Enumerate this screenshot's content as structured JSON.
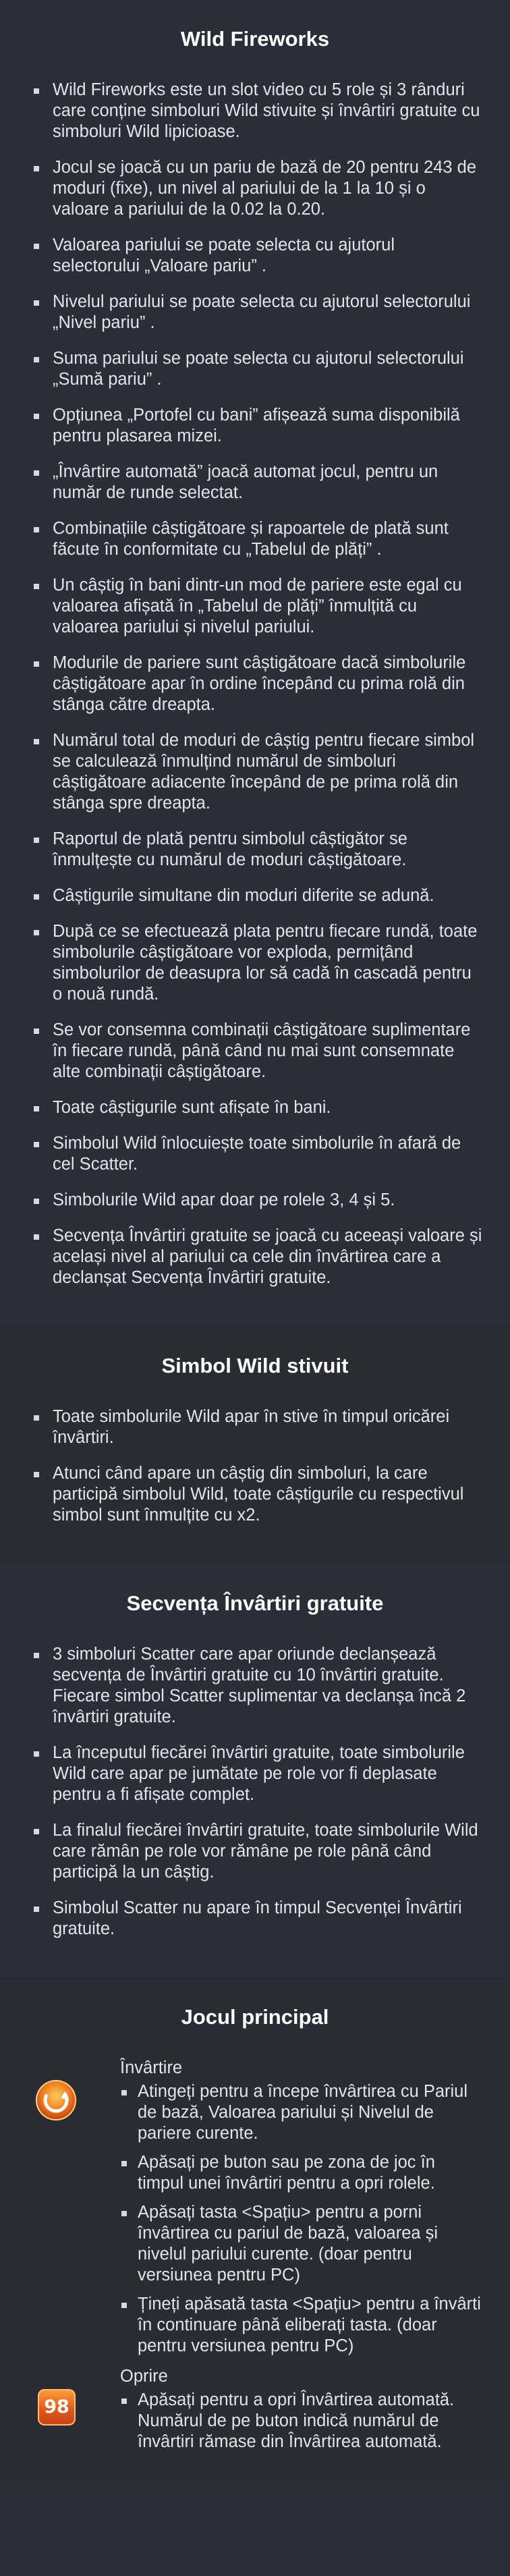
{
  "sections": [
    {
      "title": "Wild Fireworks",
      "items": [
        "Wild Fireworks este un slot video cu 5 role și 3 rânduri care conține simboluri Wild stivuite și învârtiri gratuite cu simboluri Wild lipicioase.",
        "Jocul se joacă cu un pariu de bază de 20 pentru 243 de moduri (fixe), un nivel al pariului de la 1 la 10 și o valoare a pariului de la 0.02 la 0.20.",
        "Valoarea pariului se poate selecta cu ajutorul selectorului „Valoare pariu”  .",
        "Nivelul pariului se poate selecta cu ajutorul selectorului „Nivel pariu”  .",
        "Suma pariului se poate selecta cu ajutorul selectorului „Sumă pariu”  .",
        "Opțiunea „Portofel cu bani”   afișează suma disponibilă pentru plasarea mizei.",
        "„Învârtire automată”   joacă automat jocul, pentru un număr de runde selectat.",
        "Combinațiile câștigătoare și rapoartele de plată sunt făcute în conformitate cu „Tabelul de plăți”  .",
        "Un câștig în bani dintr-un mod de pariere este egal cu valoarea afișată în „Tabelul de plăți”   înmulțită cu valoarea pariului și nivelul pariului.",
        "Modurile de pariere sunt câștigătoare dacă simbolurile câștigătoare apar în ordine începând cu prima rolă din stânga către dreapta.",
        "Numărul total de moduri de câștig pentru fiecare simbol se calculează înmulțind numărul de simboluri câștigătoare adiacente începând de pe prima rolă din stânga spre dreapta.",
        "Raportul de plată pentru simbolul câștigător se înmulțește cu numărul de moduri câștigătoare.",
        "Câștigurile simultane din moduri diferite se adună.",
        "După ce se efectuează plata pentru fiecare rundă, toate simbolurile câștigătoare vor exploda, permițând simbolurilor de deasupra lor să cadă în cascadă pentru o nouă rundă.",
        "Se vor consemna combinații câștigătoare suplimentare în fiecare rundă, până când nu mai sunt consemnate alte combinații câștigătoare.",
        "Toate câștigurile sunt afișate în bani.",
        "Simbolul Wild înlocuiește toate simbolurile în afară de cel Scatter.",
        "Simbolurile Wild apar doar pe rolele 3, 4 și 5.",
        "Secvența Învârtiri gratuite se joacă cu aceeași valoare și același nivel al pariului ca cele din învârtirea care a declanșat Secvența Învârtiri gratuite."
      ]
    },
    {
      "title": "Simbol Wild stivuit",
      "items": [
        "Toate simbolurile Wild apar în stive în timpul oricărei învârtiri.",
        "Atunci când apare un câștig din simboluri, la care participă simbolul Wild, toate câștigurile cu respectivul simbol sunt înmulțite cu x2."
      ]
    },
    {
      "title": "Secvența Învârtiri gratuite",
      "items": [
        "3 simboluri Scatter care apar oriunde declanșează secvența de Învârtiri gratuite cu 10 învârtiri gratuite. Fiecare simbol Scatter suplimentar va declanșa încă 2 învârtiri gratuite.",
        "La începutul fiecărei învârtiri gratuite, toate simbolurile Wild care apar pe jumătate pe role vor fi deplasate pentru a fi afișate complet.",
        "La finalul fiecărei învârtiri gratuite, toate simbolurile Wild care rămân pe role vor rămâne pe role până când participă la un câștig.",
        "Simbolul Scatter nu apare în timpul Secvenței Învârtiri gratuite."
      ]
    }
  ],
  "main_game": {
    "title": "Jocul principal",
    "features": [
      {
        "icon": "spin-icon",
        "title": "Învârtire",
        "items": [
          "Atingeți pentru a începe învârtirea cu Pariul de bază, Valoarea pariului și Nivelul de pariere curente.",
          "Apăsați pe buton sau pe zona de joc în timpul unei învârtiri pentru a opri rolele.",
          "Apăsați tasta <Spațiu> pentru a porni învârtirea cu pariul de bază, valoarea și nivelul pariului curente. (doar pentru versiunea pentru PC)",
          "Țineți apăsată tasta <Spațiu> pentru a învârti în continuare până eliberați tasta. (doar pentru versiunea pentru PC)"
        ]
      },
      {
        "icon": "autoplay-counter-icon",
        "icon_text": "98",
        "title": "Oprire",
        "items": [
          "Apăsați pentru a opri Învârtirea automată. Numărul de pe buton indică numărul de învârtiri rămase din Învârtirea automată."
        ]
      }
    ]
  }
}
